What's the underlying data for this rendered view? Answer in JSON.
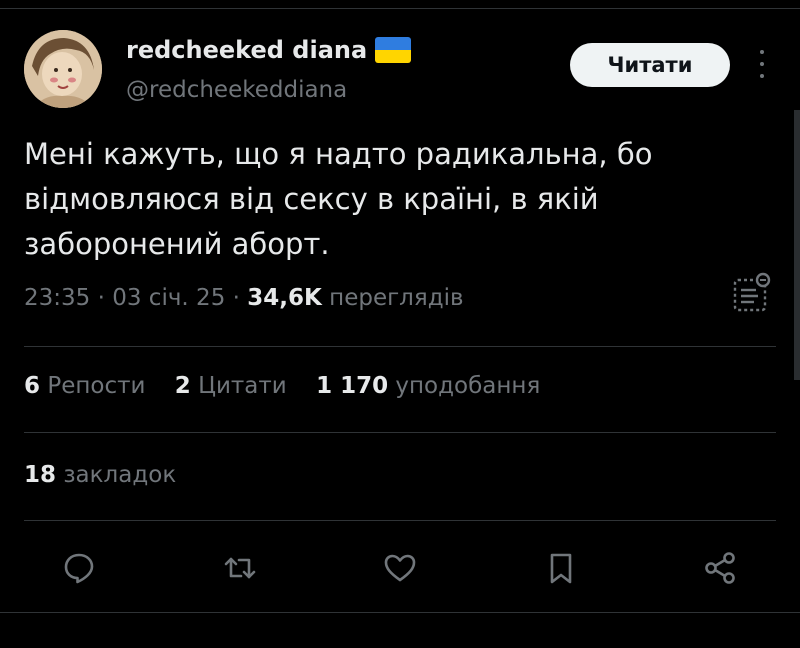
{
  "author": {
    "display_name": "redcheeked diana",
    "handle": "@redcheekeddiana",
    "flag": "ukraine-flag"
  },
  "follow_button": {
    "label": "Читати"
  },
  "tweet": {
    "lines": [
      "Мені кажуть, що я надто радикальна, бо",
      "відмовляюся від сексу в країні, в якій",
      "заборонений аборт."
    ]
  },
  "meta": {
    "time": "23:35",
    "separator": "·",
    "date": "03 січ. 25",
    "views_count": "34,6K",
    "views_label": "переглядів"
  },
  "stats": {
    "reposts_count": "6",
    "reposts_label": "Репости",
    "quotes_count": "2",
    "quotes_label": "Цитати",
    "likes_count": "1 170",
    "likes_label": "уподобання"
  },
  "bookmarks": {
    "count": "18",
    "label": "закладок"
  },
  "actions": [
    "reply-icon",
    "repost-icon",
    "like-icon",
    "bookmark-icon",
    "share-icon"
  ],
  "colors": {
    "background": "#000000",
    "primary_text": "#e7e9ea",
    "secondary_text": "#71767b",
    "divider": "#2f3336",
    "button_bg": "#eff3f4",
    "flag_blue": "#2f7de0",
    "flag_yellow": "#ffd500"
  }
}
